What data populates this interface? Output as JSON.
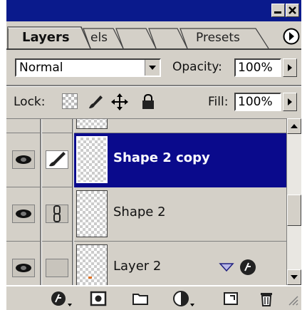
{
  "tabs": [
    {
      "label": "Layers",
      "active": true
    },
    {
      "label": "els",
      "active": false
    },
    {
      "label": "",
      "active": false
    },
    {
      "label": "",
      "active": false
    },
    {
      "label": "Presets",
      "active": false
    }
  ],
  "blend_mode": "Normal",
  "opacity": {
    "label": "Opacity:",
    "value": "100%"
  },
  "lock": {
    "label": "Lock:"
  },
  "fill": {
    "label": "Fill:",
    "value": "100%"
  },
  "layers": [
    {
      "name": "Shape 2 copy",
      "selected": true,
      "visible": true
    },
    {
      "name": "Shape 2",
      "selected": false,
      "visible": true
    },
    {
      "name": "Layer 2",
      "selected": false,
      "visible": true
    }
  ],
  "colors": {
    "titlebar": "#0a1a8c",
    "selected_row": "#0a0a8c",
    "panel": "#d4d0c8"
  },
  "bottom_icons": [
    "layer-style-icon",
    "mask-icon",
    "new-group-icon",
    "adjustment-layer-icon",
    "new-layer-icon",
    "trash-icon"
  ]
}
